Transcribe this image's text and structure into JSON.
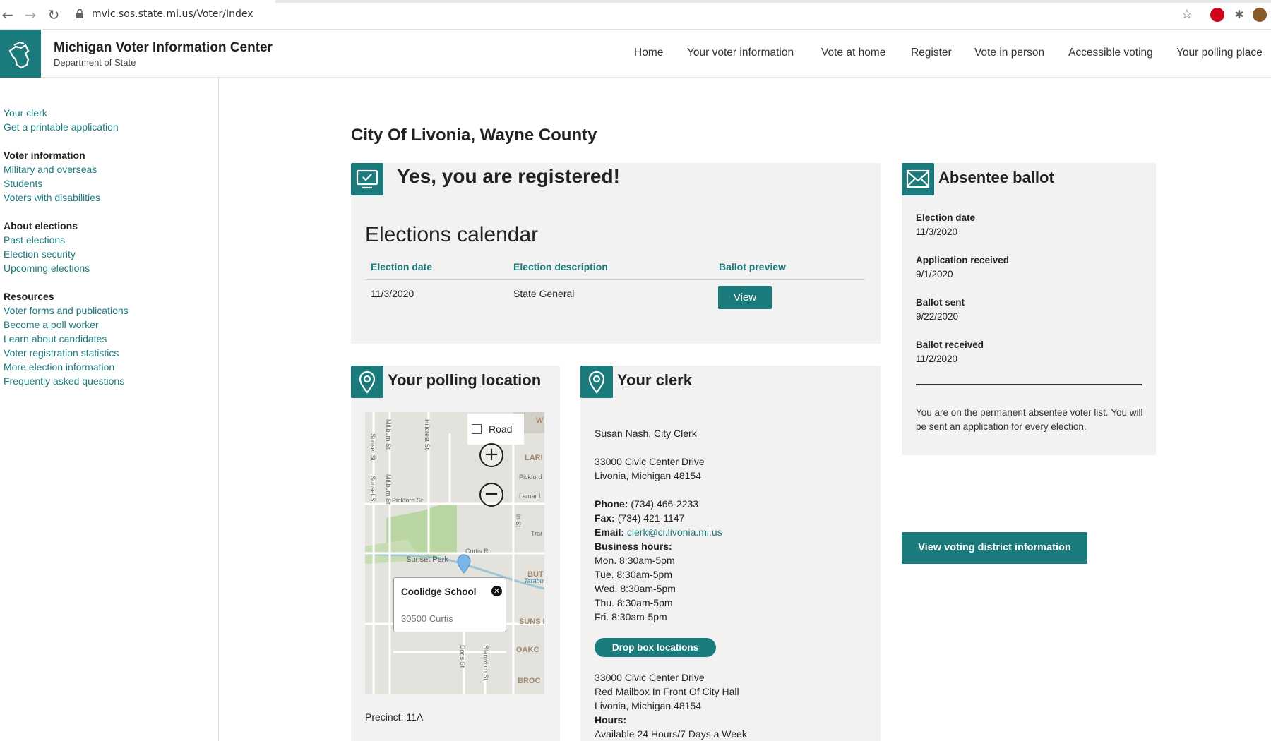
{
  "browser": {
    "url": "mvic.sos.state.mi.us/Voter/Index"
  },
  "header": {
    "title": "Michigan Voter Information Center",
    "subtitle": "Department of State",
    "nav": [
      "Home",
      "Your voter information",
      "Vote at home",
      "Register",
      "Vote in person",
      "Accessible voting",
      "Your polling place"
    ]
  },
  "sidebar": {
    "top_links": [
      "Your clerk",
      "Get a printable application"
    ],
    "groups": [
      {
        "heading": "Voter information",
        "links": [
          "Military and overseas",
          "Students",
          "Voters with disabilities"
        ]
      },
      {
        "heading": "About elections",
        "links": [
          "Past elections",
          "Election security",
          "Upcoming elections"
        ]
      },
      {
        "heading": "Resources",
        "links": [
          "Voter forms and publications",
          "Become a poll worker",
          "Learn about candidates",
          "Voter registration statistics",
          "More election information",
          "Frequently asked questions"
        ]
      }
    ]
  },
  "main": {
    "title": "City Of Livonia, Wayne County",
    "registration": {
      "status": "Yes, you are registered!",
      "calendar_title": "Elections calendar",
      "columns": [
        "Election date",
        "Election description",
        "Ballot preview"
      ],
      "rows": [
        {
          "date": "11/3/2020",
          "description": "State General",
          "action": "View"
        }
      ]
    },
    "polling": {
      "title": "Your polling location",
      "map": {
        "road_label": "Road",
        "zoom_in": "+",
        "zoom_out": "−",
        "popup_name": "Coolidge School",
        "popup_address": "30500 Curtis",
        "streets": [
          "Sunset St",
          "Millburn St",
          "Hillcrest St",
          "Pickford St",
          "Curtis Rd",
          "Sunset Park",
          "Doris St",
          "Stamwich St",
          "Tarabusi",
          "LARI",
          "Pickford",
          "Lamar L",
          "Trar",
          "BUT",
          "SUNS ES",
          "OAKC",
          "BROC",
          "SUNSET PARK",
          "W",
          "in St",
          "Sunset St",
          "Millburn St"
        ]
      },
      "precinct": "Precinct: 11A"
    },
    "clerk": {
      "title": "Your clerk",
      "name": "Susan Nash, City Clerk",
      "address1": "33000 Civic Center Drive",
      "address2": "Livonia, Michigan 48154",
      "phone_label": "Phone:",
      "phone": "(734) 466-2233",
      "fax_label": "Fax:",
      "fax": "(734) 421-1147",
      "email_label": "Email:",
      "email": "clerk@ci.livonia.mi.us",
      "hours_label": "Business hours:",
      "hours": [
        "Mon. 8:30am-5pm",
        "Tue. 8:30am-5pm",
        "Wed. 8:30am-5pm",
        "Thu. 8:30am-5pm",
        "Fri. 8:30am-5pm"
      ],
      "dropbox_button": "Drop box locations",
      "dropbox_address1": "33000 Civic Center Drive",
      "dropbox_address2": "Red Mailbox In Front Of City Hall",
      "dropbox_address3": "Livonia, Michigan 48154",
      "dropbox_hours_label": "Hours:",
      "dropbox_hours": "Available 24 Hours/7 Days a Week"
    },
    "absentee": {
      "title": "Absentee ballot",
      "items": [
        {
          "label": "Election date",
          "value": "11/3/2020"
        },
        {
          "label": "Application received",
          "value": "9/1/2020"
        },
        {
          "label": "Ballot sent",
          "value": "9/22/2020"
        },
        {
          "label": "Ballot received",
          "value": "11/2/2020"
        }
      ],
      "note": "You are on the permanent absentee voter list. You will be sent an application for every election."
    },
    "district_button": "View voting district information"
  },
  "colors": {
    "brand_teal": "#1b7a7b",
    "link_teal": "#1a7a7d",
    "card_bg": "#f2f2f2"
  }
}
